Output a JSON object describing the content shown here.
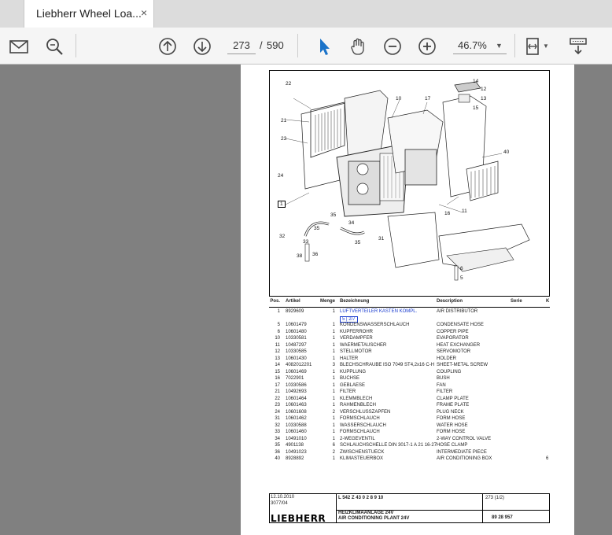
{
  "tab": {
    "title": "Liebherr Wheel Loa...",
    "close": "×"
  },
  "toolbar": {
    "icons": [
      "email-icon",
      "zoom-search-icon",
      "page-up-icon",
      "page-down-icon",
      "select-cursor-icon",
      "hand-tool-icon",
      "zoom-out-icon",
      "zoom-in-icon",
      "fit-page-icon",
      "scroll-mode-icon"
    ],
    "page_current": "273",
    "page_separator": "/",
    "page_total": "590",
    "zoom": "46.7%"
  },
  "drawing": {
    "callouts": [
      "22",
      "10",
      "17",
      "14",
      "12",
      "13",
      "15",
      "21",
      "23",
      "40",
      "24",
      "1",
      "16",
      "11",
      "35",
      "34",
      "31",
      "32",
      "35",
      "35",
      "33",
      "6",
      "5",
      "38",
      "36"
    ]
  },
  "parts": {
    "headers": {
      "pos": "Pos.",
      "artikel": "Artikel",
      "menge": "Menge",
      "bezeichnung": "Bezeichnung",
      "description": "Description",
      "serie": "Serie",
      "k": "K"
    },
    "rows": [
      {
        "pos": "1",
        "art": "8929609",
        "qty": "1",
        "bez": "LUFTVERTEILER KASTEN KOMPL.",
        "desc": "AIR DISTRIBUTOR",
        "serie": "",
        "k": ""
      },
      {
        "pos": "",
        "art": "",
        "qty": "",
        "bez": "5 | 2/7",
        "desc": "",
        "serie": "",
        "k": ""
      },
      {
        "pos": "5",
        "art": "10601479",
        "qty": "1",
        "bez": "KONDENSWASSERSCHLAUCH",
        "desc": "CONDENSATE HOSE",
        "serie": "",
        "k": ""
      },
      {
        "pos": "6",
        "art": "10601480",
        "qty": "1",
        "bez": "KUPFERROHR",
        "desc": "COPPER PIPE",
        "serie": "",
        "k": ""
      },
      {
        "pos": "10",
        "art": "10330581",
        "qty": "1",
        "bez": "VERDAMPFER",
        "desc": "EVAPORATOR",
        "serie": "",
        "k": ""
      },
      {
        "pos": "11",
        "art": "10487297",
        "qty": "1",
        "bez": "WAERMETAUSCHER",
        "desc": "HEAT EXCHANGER",
        "serie": "",
        "k": ""
      },
      {
        "pos": "12",
        "art": "10330585",
        "qty": "1",
        "bez": "STELLMOTOR",
        "desc": "SERVOMOTOR",
        "serie": "",
        "k": ""
      },
      {
        "pos": "13",
        "art": "10601430",
        "qty": "1",
        "bez": "HALTER",
        "desc": "HOLDER",
        "serie": "",
        "k": ""
      },
      {
        "pos": "14",
        "art": "4082012201",
        "qty": "3",
        "bez": "BLECHSCHRAUBE ISO 7049 ST4,2x16 C-H",
        "desc": "SHEET-METAL SCREW",
        "serie": "",
        "k": ""
      },
      {
        "pos": "15",
        "art": "10601469",
        "qty": "1",
        "bez": "KUPPLUNG",
        "desc": "COUPLING",
        "serie": "",
        "k": ""
      },
      {
        "pos": "16",
        "art": "7022901",
        "qty": "1",
        "bez": "BUCHSE",
        "desc": "BUSH",
        "serie": "",
        "k": ""
      },
      {
        "pos": "17",
        "art": "10330586",
        "qty": "1",
        "bez": "GEBLAESE",
        "desc": "FAN",
        "serie": "",
        "k": ""
      },
      {
        "pos": "21",
        "art": "10492693",
        "qty": "1",
        "bez": "FILTER",
        "desc": "FILTER",
        "serie": "",
        "k": ""
      },
      {
        "pos": "22",
        "art": "10601464",
        "qty": "1",
        "bez": "KLEMMBLECH",
        "desc": "CLAMP PLATE",
        "serie": "",
        "k": ""
      },
      {
        "pos": "23",
        "art": "10601463",
        "qty": "1",
        "bez": "RAHMENBLECH",
        "desc": "FRAME PLATE",
        "serie": "",
        "k": ""
      },
      {
        "pos": "24",
        "art": "10601608",
        "qty": "2",
        "bez": "VERSCHLUSSZAPFEN",
        "desc": "PLUG NECK",
        "serie": "",
        "k": ""
      },
      {
        "pos": "31",
        "art": "10601462",
        "qty": "1",
        "bez": "FORMSCHLAUCH",
        "desc": "FORM HOSE",
        "serie": "",
        "k": ""
      },
      {
        "pos": "32",
        "art": "10330588",
        "qty": "1",
        "bez": "WASSERSCHLAUCH",
        "desc": "WATER HOSE",
        "serie": "",
        "k": ""
      },
      {
        "pos": "33",
        "art": "10601460",
        "qty": "1",
        "bez": "FORMSCHLAUCH",
        "desc": "FORM HOSE",
        "serie": "",
        "k": ""
      },
      {
        "pos": "34",
        "art": "10491010",
        "qty": "1",
        "bez": "2-WEGEVENTIL",
        "desc": "2-WAY CONTROL VALVE",
        "serie": "",
        "k": ""
      },
      {
        "pos": "35",
        "art": "4901138",
        "qty": "6",
        "bez": "SCHLAUCHSCHELLE DIN 3017-1 A 21 16-27",
        "desc": "HOSE CLAMP",
        "serie": "",
        "k": ""
      },
      {
        "pos": "36",
        "art": "10491023",
        "qty": "2",
        "bez": "ZWISCHENSTUECK",
        "desc": "INTERMEDIATE PIECE",
        "serie": "",
        "k": ""
      },
      {
        "pos": "40",
        "art": "8928892",
        "qty": "1",
        "bez": "KLIMASTEUERBOX",
        "desc": "AIR CONDITIONING BOX",
        "serie": "",
        "k": "6"
      }
    ]
  },
  "titleblock": {
    "date": "12.10.2010",
    "code": "3077/04",
    "machine": "L  542  Z  43 0  2 8 9 10",
    "title_de": "HEIZKLIMAANLAGE 24V",
    "title_en": "AIR CONDITIONING PLANT 24V",
    "page_ref": "273 (1/2)",
    "drawing_no": "89 28 957",
    "logo": "LIEBHERR"
  }
}
